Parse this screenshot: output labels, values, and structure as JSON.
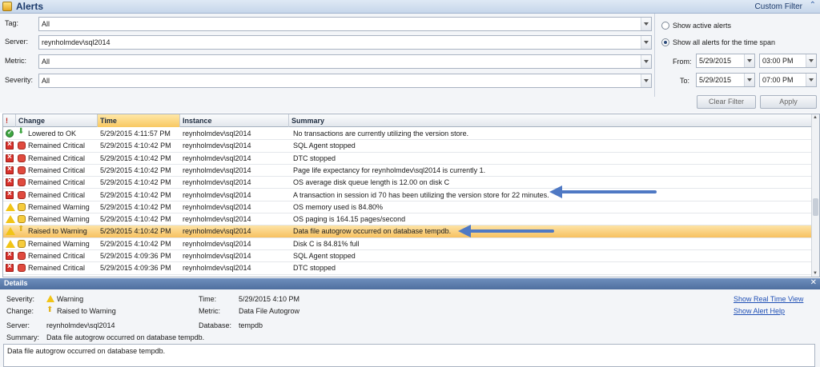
{
  "header": {
    "title": "Alerts",
    "custom_filter": "Custom Filter"
  },
  "filters": {
    "tag": {
      "label": "Tag:",
      "value": "All"
    },
    "server": {
      "label": "Server:",
      "value": "reynholmdev\\sql2014"
    },
    "metric": {
      "label": "Metric:",
      "value": "All"
    },
    "severity": {
      "label": "Severity:",
      "value": "All"
    },
    "show_active": "Show active alerts",
    "show_all": "Show all alerts for the time span",
    "from_label": "From:",
    "to_label": "To:",
    "from_date": "5/29/2015",
    "from_time": "03:00 PM",
    "to_date": "5/29/2015",
    "to_time": "07:00 PM",
    "clear_filter": "Clear Filter",
    "apply": "Apply"
  },
  "grid": {
    "columns": {
      "change": "Change",
      "time": "Time",
      "instance": "Instance",
      "summary": "Summary"
    },
    "rows": [
      {
        "sev": "ok",
        "chg": "down",
        "change": "Lowered to OK",
        "time": "5/29/2015 4:11:57 PM",
        "instance": "reynholmdev\\sql2014",
        "summary": "No transactions are currently utilizing the version store."
      },
      {
        "sev": "crit",
        "chg": "crit",
        "change": "Remained Critical",
        "time": "5/29/2015 4:10:42 PM",
        "instance": "reynholmdev\\sql2014",
        "summary": "SQL Agent stopped"
      },
      {
        "sev": "crit",
        "chg": "crit",
        "change": "Remained Critical",
        "time": "5/29/2015 4:10:42 PM",
        "instance": "reynholmdev\\sql2014",
        "summary": "DTC stopped"
      },
      {
        "sev": "crit",
        "chg": "crit",
        "change": "Remained Critical",
        "time": "5/29/2015 4:10:42 PM",
        "instance": "reynholmdev\\sql2014",
        "summary": "Page life expectancy for reynholmdev\\sql2014 is currently 1."
      },
      {
        "sev": "crit",
        "chg": "crit",
        "change": "Remained Critical",
        "time": "5/29/2015 4:10:42 PM",
        "instance": "reynholmdev\\sql2014",
        "summary": "OS average disk queue length is 12.00 on disk C"
      },
      {
        "sev": "crit",
        "chg": "crit",
        "change": "Remained Critical",
        "time": "5/29/2015 4:10:42 PM",
        "instance": "reynholmdev\\sql2014",
        "summary": "A transaction in session id 70 has been utilizing the version store for 22 minutes."
      },
      {
        "sev": "warn",
        "chg": "warn",
        "change": "Remained Warning",
        "time": "5/29/2015 4:10:42 PM",
        "instance": "reynholmdev\\sql2014",
        "summary": "OS memory used is 84.80%"
      },
      {
        "sev": "warn",
        "chg": "warn",
        "change": "Remained Warning",
        "time": "5/29/2015 4:10:42 PM",
        "instance": "reynholmdev\\sql2014",
        "summary": "OS paging is 164.15 pages/second"
      },
      {
        "sev": "warn",
        "chg": "up",
        "change": "Raised to Warning",
        "time": "5/29/2015 4:10:42 PM",
        "instance": "reynholmdev\\sql2014",
        "summary": "Data file autogrow occurred on database tempdb."
      },
      {
        "sev": "warn",
        "chg": "warn",
        "change": "Remained Warning",
        "time": "5/29/2015 4:10:42 PM",
        "instance": "reynholmdev\\sql2014",
        "summary": "Disk C is 84.81% full"
      },
      {
        "sev": "crit",
        "chg": "crit",
        "change": "Remained Critical",
        "time": "5/29/2015 4:09:36 PM",
        "instance": "reynholmdev\\sql2014",
        "summary": "SQL Agent stopped"
      },
      {
        "sev": "crit",
        "chg": "crit",
        "change": "Remained Critical",
        "time": "5/29/2015 4:09:36 PM",
        "instance": "reynholmdev\\sql2014",
        "summary": "DTC stopped"
      }
    ]
  },
  "details": {
    "title": "Details",
    "severity_label": "Severity:",
    "severity_value": "Warning",
    "change_label": "Change:",
    "change_value": "Raised to Warning",
    "server_label": "Server:",
    "server_value": "reynholmdev\\sql2014",
    "summary_label": "Summary:",
    "summary_value": "Data file autogrow occurred on database tempdb.",
    "time_label": "Time:",
    "time_value": "5/29/2015 4:10 PM",
    "metric_label": "Metric:",
    "metric_value": "Data File Autogrow",
    "database_label": "Database:",
    "database_value": "tempdb",
    "show_realtime": "Show Real Time View",
    "show_help": "Show Alert Help",
    "message": "Data file autogrow occurred on database tempdb."
  }
}
